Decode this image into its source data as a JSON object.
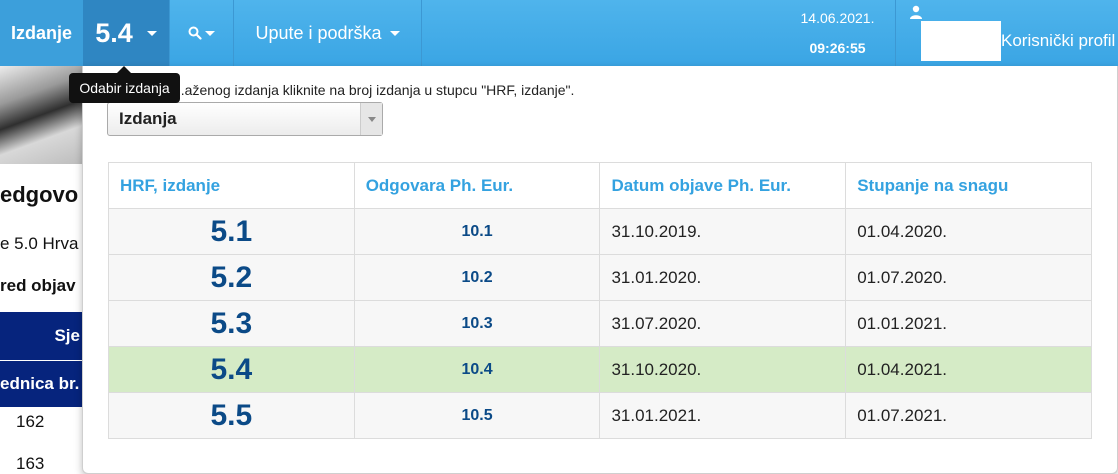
{
  "navbar": {
    "brand": "Izdanje",
    "current_edition": "5.4",
    "help_label": "Upute i podrška",
    "date": "14.06.2021.",
    "time": "09:26:55",
    "user_label": "Korisnički profil"
  },
  "tooltip": {
    "text": "Odabir izdanja"
  },
  "background_page": {
    "heading": "edgovo",
    "subtitle": "e 5.0 Hrva",
    "bold_text": "red objav",
    "blue_header_1": "Sje",
    "blue_header_2": "ednica br.",
    "row_values": [
      "162",
      "163"
    ]
  },
  "dropdown": {
    "instruction": "...aženog izdanja kliknite na broj izdanja u stupcu \"HRF, izdanje\".",
    "select_value": "Izdanja",
    "columns": [
      "HRF, izdanje",
      "Odgovara Ph. Eur.",
      "Datum objave Ph. Eur.",
      "Stupanje na snagu"
    ],
    "rows": [
      {
        "edition": "5.1",
        "ph_eur": "10.1",
        "published": "31.10.2019.",
        "effective": "01.04.2020."
      },
      {
        "edition": "5.2",
        "ph_eur": "10.2",
        "published": "31.01.2020.",
        "effective": "01.07.2020."
      },
      {
        "edition": "5.3",
        "ph_eur": "10.3",
        "published": "31.07.2020.",
        "effective": "01.01.2021."
      },
      {
        "edition": "5.4",
        "ph_eur": "10.4",
        "published": "31.10.2020.",
        "effective": "01.04.2021."
      },
      {
        "edition": "5.5",
        "ph_eur": "10.5",
        "published": "31.01.2021.",
        "effective": "01.07.2021."
      }
    ],
    "selected_edition": "5.4"
  },
  "colors": {
    "navbar": "#3aa5e4",
    "navbar_active": "#2f86c2",
    "header_text": "#34a2e0",
    "edition_text": "#0b4a87",
    "selected_row": "#d5ebc6",
    "table_blue": "#06247d"
  },
  "icons": {
    "search": "search-icon",
    "user": "user-icon",
    "caret": "caret-down-icon"
  }
}
